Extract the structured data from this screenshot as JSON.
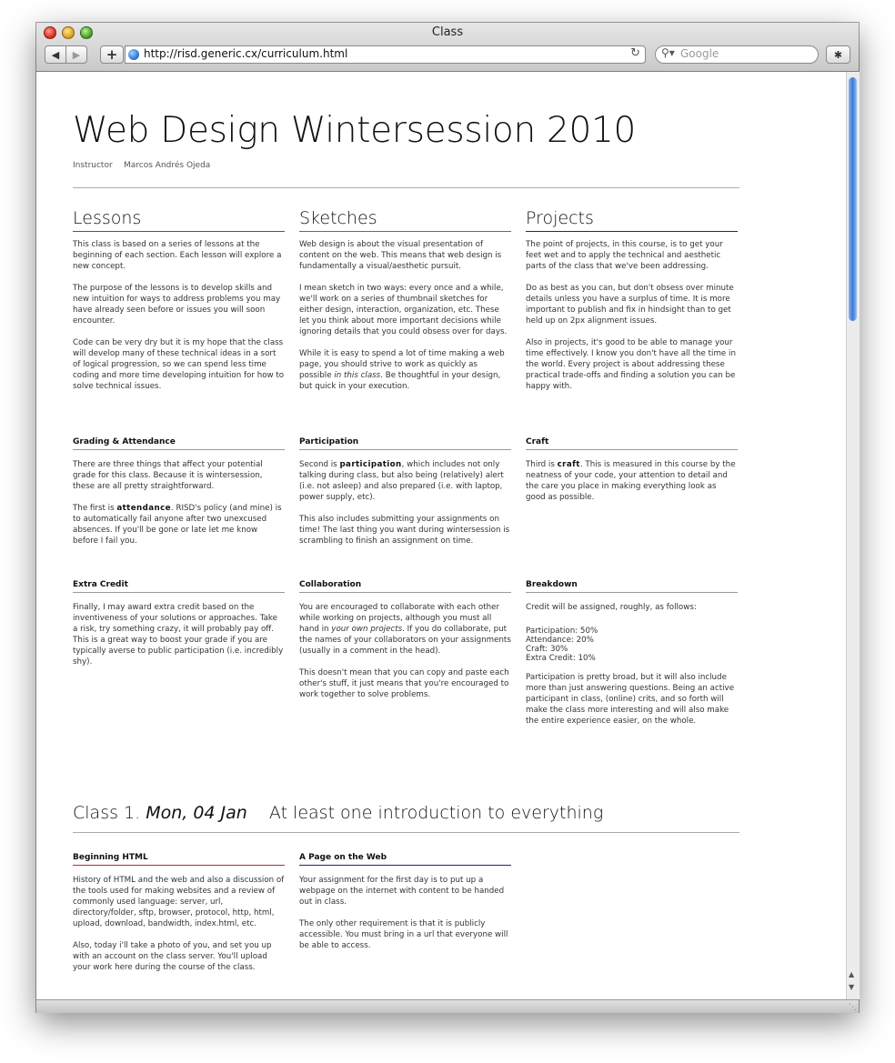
{
  "window": {
    "title": "Class"
  },
  "toolbar": {
    "back_label": "◀",
    "forward_label": "▶",
    "add_label": "+",
    "url": "http://risd.generic.cx/curriculum.html",
    "reload_label": "↻",
    "search_placeholder": "Google",
    "bug_label": "✱"
  },
  "page": {
    "title": "Web Design Wintersession 2010",
    "instructor_label": "Instructor",
    "instructor_name": "Marcos Andrés Ojeda",
    "lessons": {
      "heading": "Lessons",
      "p1": "This class is based on a series of lessons at the beginning of each section. Each lesson will explore a new concept.",
      "p2": "The purpose of the lessons is to develop skills and new intuition for ways to address problems you may have already seen before or issues you will soon encounter.",
      "p3": "Code can be very dry but it is my hope that the class will develop many of these technical ideas in a sort of logical progression, so we can spend less time coding and more time developing intuition for how to solve technical issues."
    },
    "sketches": {
      "heading": "Sketches",
      "p1": "Web design is about the visual presentation of content on the web. This means that web design is fundamentally a visual/aesthetic pursuit.",
      "p2": "I mean sketch in two ways: every once and a while, we'll work on a series of thumbnail sketches for either design, interaction, organization, etc. These let you think about more important decisions while ignoring details that you could obsess over for days.",
      "p3_a": "While it is easy to spend a lot of time making a web page, you should strive to work as quickly as possible ",
      "p3_em": "in this class",
      "p3_b": ". Be thoughtful in your design, but quick in your execution."
    },
    "projects": {
      "heading": "Projects",
      "p1": "The point of projects, in this course, is to get your feet wet and to apply the technical and aesthetic parts of the class that we've been addressing.",
      "p2": "Do as best as you can, but don't obsess over minute details unless you have a surplus of time. It is more important to publish and fix in hindsight than to get held up on 2px alignment issues.",
      "p3": "Also in projects, it's good to be able to manage your time effectively. I know you don't have all the time in the world. Every project is about addressing these practical trade-offs and finding a solution you can be happy with."
    },
    "grading": {
      "heading": "Grading & Attendance",
      "p1": "There are three things that affect your potential grade for this class. Because it is wintersession, these are all pretty straightforward.",
      "p2_a": "The first is ",
      "p2_strong": "attendance",
      "p2_b": ". RISD's policy (and mine) is to automatically fail anyone after two unexcused absences. If you'll be gone or late let me know before I fail you."
    },
    "participation": {
      "heading": "Participation",
      "p1_a": "Second is ",
      "p1_strong": "participation",
      "p1_b": ", which includes not only talking during class, but also being (relatively) alert (i.e. not asleep) and also prepared (i.e. with laptop, power supply, etc).",
      "p2": "This also includes submitting your assignments on time! The last thing you want during wintersession is scrambling to finish an assignment on time."
    },
    "craft": {
      "heading": "Craft",
      "p1_a": "Third is ",
      "p1_strong": "craft",
      "p1_b": ". This is measured in this course by the neatness of your code, your attention to detail and the care you place in making everything look as good as possible."
    },
    "extra_credit": {
      "heading": "Extra Credit",
      "p1": "Finally, I may award extra credit based on the inventiveness of your solutions or approaches. Take a risk, try something crazy, it will probably pay off. This is a great way to boost your grade if you are typically averse to public participation (i.e. incredibly shy)."
    },
    "collaboration": {
      "heading": "Collaboration",
      "p1_a": "You are encouraged to collaborate with each other while working on projects, although you must all hand in ",
      "p1_em": "your own projects",
      "p1_b": ". If you do collaborate, put the names of your collaborators on your assignments (usually in a comment in the head).",
      "p2": "This doesn't mean that you can copy and paste each other's stuff, it just means that you're encouraged to work together to solve problems."
    },
    "breakdown": {
      "heading": "Breakdown",
      "p1": "Credit will be assigned, roughly, as follows:",
      "items": [
        "Participation: 50%",
        "Attendance: 20%",
        "Craft: 30%",
        "Extra Credit: 10%"
      ],
      "p2": "Participation is pretty broad, but it will also include more than just answering questions. Being an active participant in class, (online) crits, and so forth will make the class more interesting and will also make the entire experience easier, on the whole."
    },
    "class1": {
      "prefix": "Class 1.",
      "date": "Mon, 04 Jan",
      "topic": "At least one introduction to everything",
      "beginning_html": {
        "heading": "Beginning HTML",
        "p1": "History of HTML and the web and also a discussion of the tools used for making websites and a review of commonly used language: server, url, directory/folder, sftp, browser, protocol, http, html, upload, download, bandwidth, index.html, etc.",
        "p2": "Also, today i'll take a photo of you, and set you up with an account on the class server. You'll upload your work here during the course of the class."
      },
      "page_on_web": {
        "heading": "A Page on the Web",
        "p1": "Your assignment for the first day is to put up a webpage on the internet with content to be handed out in class.",
        "p2": "The only other requirement is that it is publicly accessible. You must bring in a url that everyone will be able to access."
      }
    }
  }
}
